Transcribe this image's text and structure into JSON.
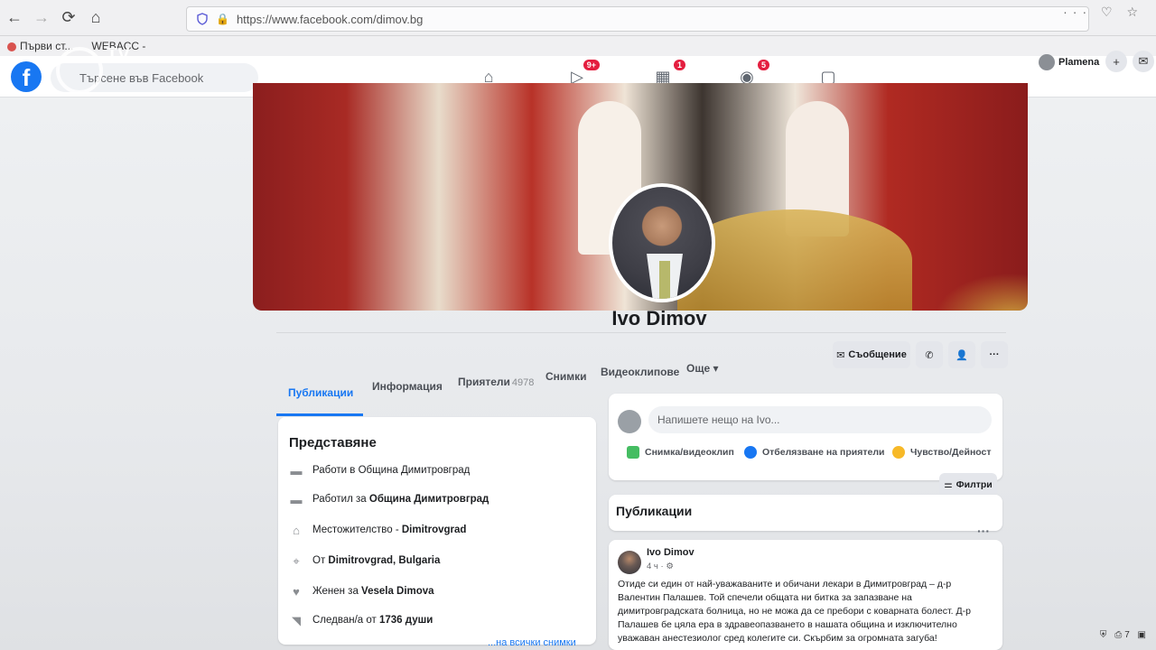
{
  "browser": {
    "url": "https://www.facebook.com/dimov.bg",
    "bookmarks": [
      "Първи ст...",
      "WEBACC -"
    ]
  },
  "watermark": {
    "logo_text": "TV"
  },
  "fb": {
    "search_placeholder": "Търсене във Facebook",
    "nav_badges": {
      "watch": "9+",
      "marketplace": "1",
      "groups": "5"
    },
    "user_name": "Plamena"
  },
  "profile": {
    "name": "Ivo Dimov",
    "actions": {
      "message": "Съобщение"
    }
  },
  "tabs": [
    {
      "label": "Публикации"
    },
    {
      "label": "Информация"
    },
    {
      "label": "Приятели",
      "count": "4978"
    },
    {
      "label": "Снимки"
    },
    {
      "label": "Видеоклипове"
    },
    {
      "label": "Още ▾"
    }
  ],
  "intro": {
    "title": "Представяне",
    "rows": [
      {
        "text": "Работи в Община Димитровград",
        "bold": ""
      },
      {
        "text": "Работил за ",
        "bold": "Община Димитровград"
      },
      {
        "text": "Местожителство - ",
        "bold": "Dimitrovgrad"
      },
      {
        "text": "От ",
        "bold": "Dimitrovgrad, Bulgaria"
      },
      {
        "text": "Женен за ",
        "bold": "Vesela Dimova"
      },
      {
        "text": "Следван/а от ",
        "bold": "1736 души"
      }
    ],
    "see_all": "...на всички снимки"
  },
  "composer": {
    "placeholder": "Напишете нещо на Ivo...",
    "actions": [
      "Снимка/видеоклип",
      "Отбелязване на приятели",
      "Чувство/Дейност"
    ]
  },
  "filters_label": "Филтри",
  "publications_title": "Публикации",
  "post": {
    "author": "Ivo Dimov",
    "time": "4 ч · ⚙",
    "more": "···",
    "text": "Отиде си един от най-уважаваните и обичани лекари в Димитровград – д-р Валентин Палашев. Той спечели общата ни битка за запазване на димитровградската болница, но не можа да се пребори с коварната болест. Д-р Палашев бе цяла ера в здравеопазването в нашата община и изключително уважаван анестезиолог сред колегите си. Скърбим за огромната загуба!"
  },
  "tray": "⛨ ⎙7 ▣"
}
